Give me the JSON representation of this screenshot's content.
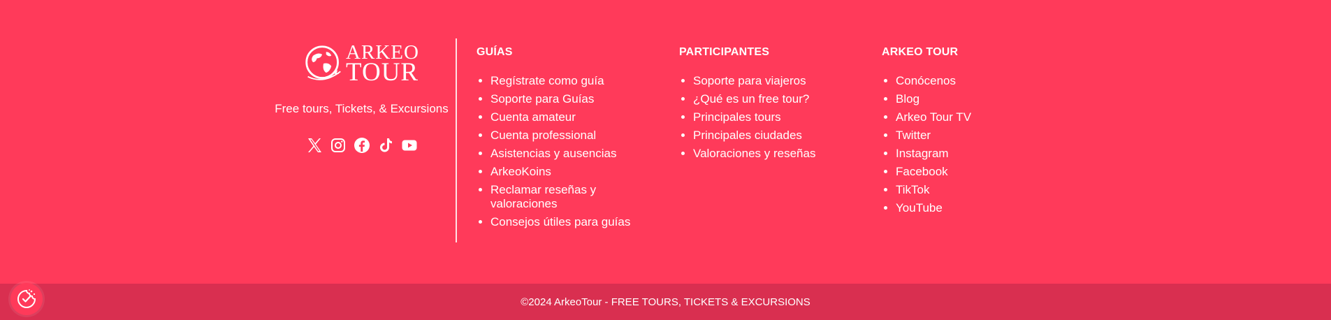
{
  "brand": {
    "logo_line1": "ARKEO",
    "logo_line2": "TOUR",
    "tagline": "Free tours, Tickets, & Excursions",
    "socials": [
      "x-icon",
      "instagram-icon",
      "facebook-icon",
      "tiktok-icon",
      "youtube-icon"
    ]
  },
  "columns": {
    "guias": {
      "title": "GUÍAS",
      "items": [
        "Regístrate como guía",
        "Soporte para Guías",
        "Cuenta amateur",
        "Cuenta professional",
        "Asistencias y ausencias",
        "ArkeoKoins",
        "Reclamar reseñas y valoraciones",
        "Consejos útiles para guías"
      ]
    },
    "participantes": {
      "title": "PARTICIPANTES",
      "items": [
        "Soporte para viajeros",
        "¿Qué es un free tour?",
        "Principales tours",
        "Principales ciudades",
        "Valoraciones y reseñas"
      ]
    },
    "arkeo": {
      "title": "ARKEO TOUR",
      "items": [
        "Conócenos",
        "Blog",
        "Arkeo Tour TV",
        "Twitter",
        "Instagram",
        "Facebook",
        "TikTok",
        "YouTube"
      ]
    }
  },
  "bottom": {
    "copyright": "©2024 ArkeoTour - FREE TOURS, TICKETS & EXCURSIONS"
  },
  "colors": {
    "background": "#ff3a5a",
    "bottom_bar": "#d92f50",
    "text": "#ffffff"
  }
}
